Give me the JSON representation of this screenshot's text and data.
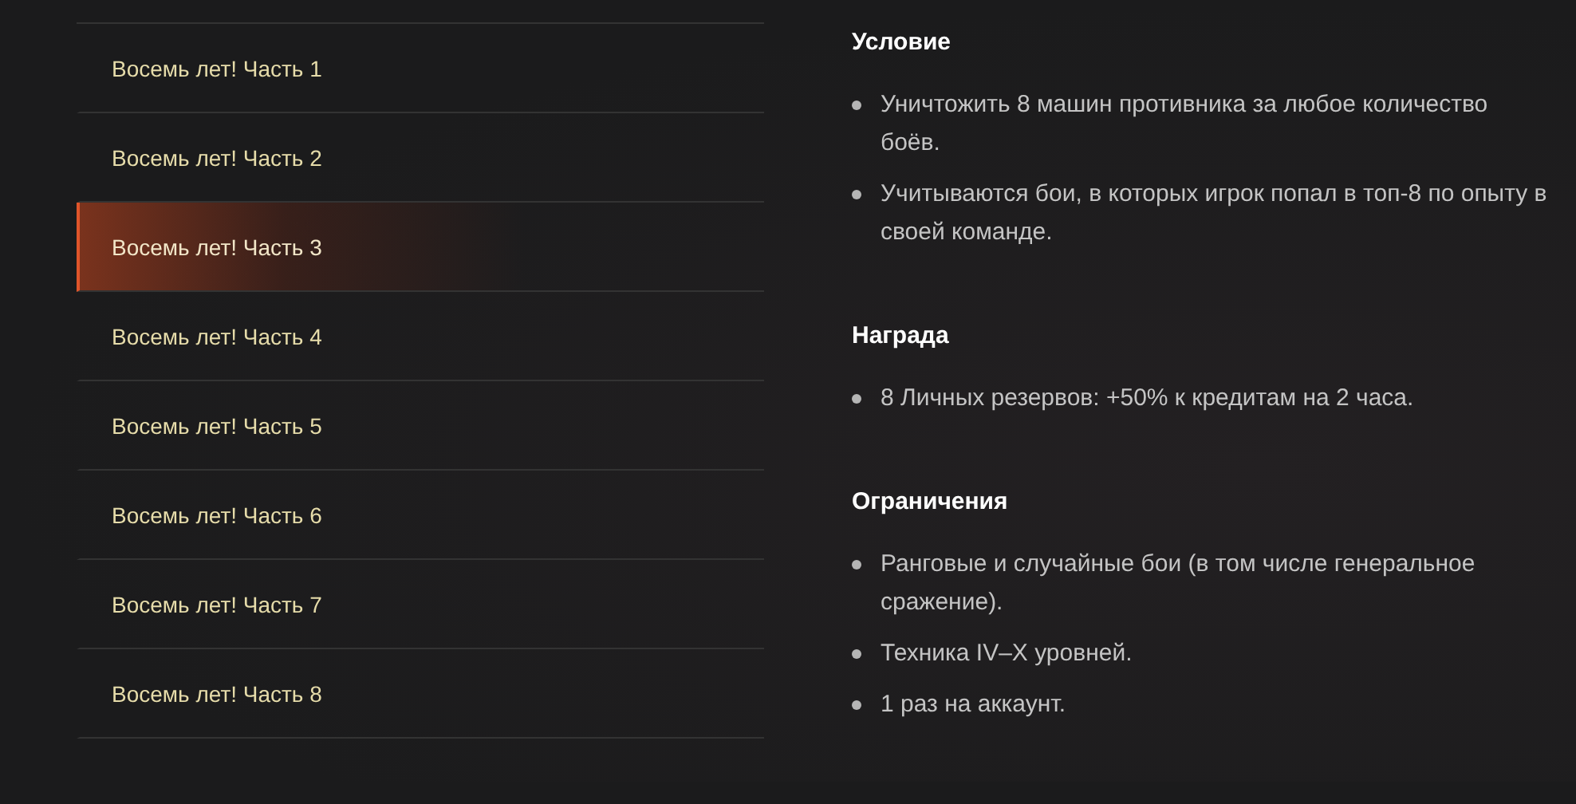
{
  "quests": [
    {
      "label": "Восемь лет! Часть 1",
      "selected": false
    },
    {
      "label": "Восемь лет! Часть 2",
      "selected": false
    },
    {
      "label": "Восемь лет! Часть 3",
      "selected": true
    },
    {
      "label": "Восемь лет! Часть 4",
      "selected": false
    },
    {
      "label": "Восемь лет! Часть 5",
      "selected": false
    },
    {
      "label": "Восемь лет! Часть 6",
      "selected": false
    },
    {
      "label": "Восемь лет! Часть 7",
      "selected": false
    },
    {
      "label": "Восемь лет! Часть 8",
      "selected": false
    }
  ],
  "sections": [
    {
      "title": "Условие",
      "items": [
        "Уничтожить 8 машин противника за любое количество боёв.",
        "Учитываются бои, в которых игрок попал в топ-8 по опыту в своей команде."
      ]
    },
    {
      "title": "Награда",
      "items": [
        "8 Личных резервов: +50% к кредитам на 2 часа."
      ]
    },
    {
      "title": "Ограничения",
      "items": [
        "Ранговые и случайные бои (в том числе генеральное сражение).",
        "Техника IV–X уровней.",
        "1 раз на аккаунт."
      ]
    }
  ]
}
